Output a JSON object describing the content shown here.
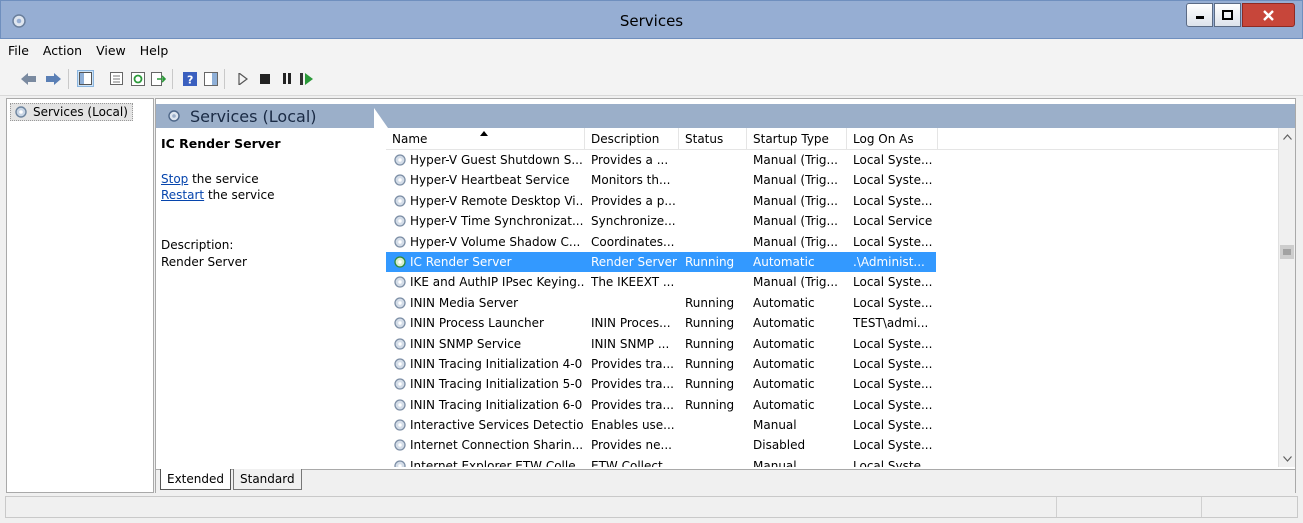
{
  "window": {
    "title": "Services"
  },
  "menu": [
    "File",
    "Action",
    "View",
    "Help"
  ],
  "toolbar": {
    "icons": [
      "back-arrow-icon",
      "forward-arrow-icon",
      "show-hide-tree-icon",
      "properties-icon",
      "refresh-icon",
      "export-list-icon",
      "help-icon",
      "show-action-pane-icon",
      "start-service-icon",
      "stop-service-icon",
      "pause-service-icon",
      "resume-service-icon"
    ]
  },
  "tree": {
    "root_label": "Services (Local)"
  },
  "pane": {
    "header_title": "Services (Local)",
    "selected_service": "IC Render Server",
    "stop_link": "Stop",
    "stop_suffix": " the service",
    "restart_link": "Restart",
    "restart_suffix": " the service",
    "description_label": "Description:",
    "description_text": "Render Server"
  },
  "table": {
    "columns": [
      "Name",
      "Description",
      "Status",
      "Startup Type",
      "Log On As"
    ],
    "rows": [
      {
        "name": "Hyper-V Guest Shutdown S...",
        "description": "Provides a ...",
        "status": "",
        "startup": "Manual (Trig...",
        "logon": "Local Syste..."
      },
      {
        "name": "Hyper-V Heartbeat Service",
        "description": "Monitors th...",
        "status": "",
        "startup": "Manual (Trig...",
        "logon": "Local Syste..."
      },
      {
        "name": "Hyper-V Remote Desktop Vi...",
        "description": "Provides a p...",
        "status": "",
        "startup": "Manual (Trig...",
        "logon": "Local Syste..."
      },
      {
        "name": "Hyper-V Time Synchronizat...",
        "description": "Synchronize...",
        "status": "",
        "startup": "Manual (Trig...",
        "logon": "Local Service"
      },
      {
        "name": "Hyper-V Volume Shadow C...",
        "description": "Coordinates...",
        "status": "",
        "startup": "Manual (Trig...",
        "logon": "Local Syste..."
      },
      {
        "name": "IC Render Server",
        "description": "Render Server",
        "status": "Running",
        "startup": "Automatic",
        "logon": ".\\Administ...",
        "selected": true
      },
      {
        "name": "IKE and AuthIP IPsec Keying...",
        "description": "The IKEEXT ...",
        "status": "",
        "startup": "Manual (Trig...",
        "logon": "Local Syste..."
      },
      {
        "name": "ININ Media Server",
        "description": "",
        "status": "Running",
        "startup": "Automatic",
        "logon": "Local Syste..."
      },
      {
        "name": "ININ Process Launcher",
        "description": "ININ Proces...",
        "status": "Running",
        "startup": "Automatic",
        "logon": "TEST\\admi..."
      },
      {
        "name": "ININ SNMP Service",
        "description": "ININ SNMP ...",
        "status": "Running",
        "startup": "Automatic",
        "logon": "Local Syste..."
      },
      {
        "name": "ININ Tracing Initialization 4-0",
        "description": "Provides tra...",
        "status": "Running",
        "startup": "Automatic",
        "logon": "Local Syste..."
      },
      {
        "name": "ININ Tracing Initialization 5-0",
        "description": "Provides tra...",
        "status": "Running",
        "startup": "Automatic",
        "logon": "Local Syste..."
      },
      {
        "name": "ININ Tracing Initialization 6-0",
        "description": "Provides tra...",
        "status": "Running",
        "startup": "Automatic",
        "logon": "Local Syste..."
      },
      {
        "name": "Interactive Services Detection",
        "description": "Enables use...",
        "status": "",
        "startup": "Manual",
        "logon": "Local Syste..."
      },
      {
        "name": "Internet Connection Sharin...",
        "description": "Provides ne...",
        "status": "",
        "startup": "Disabled",
        "logon": "Local Syste..."
      },
      {
        "name": "Internet Explorer ETW Colle...",
        "description": "ETW Collect...",
        "status": "",
        "startup": "Manual",
        "logon": "Local Syste..."
      }
    ]
  },
  "view_tabs": [
    "Extended",
    "Standard"
  ],
  "colors": {
    "selection": "#3399ff",
    "header_band": "#9bafc9",
    "titlebar": "#96aed3",
    "link": "#0645ad"
  }
}
